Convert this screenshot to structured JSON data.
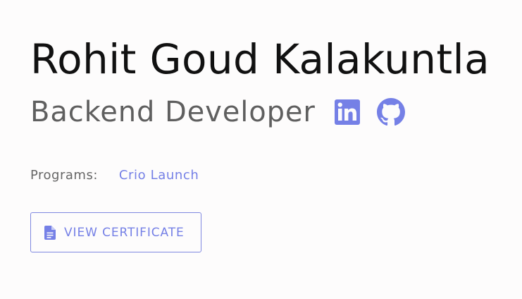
{
  "profile": {
    "name": "Rohit Goud Kalakuntla",
    "role": "Backend Developer",
    "social": {
      "linkedin_icon": "linkedin-icon",
      "github_icon": "github-icon"
    },
    "programs": {
      "label": "Programs:",
      "items": [
        "Crio Launch"
      ]
    },
    "certificate_button": {
      "label": "VIEW CERTIFICATE",
      "icon": "document-icon"
    }
  },
  "colors": {
    "accent": "#7580e6",
    "name_text": "#111111",
    "role_text": "#5f5f5f",
    "label_text": "#666666",
    "background": "#fdfcfc"
  }
}
